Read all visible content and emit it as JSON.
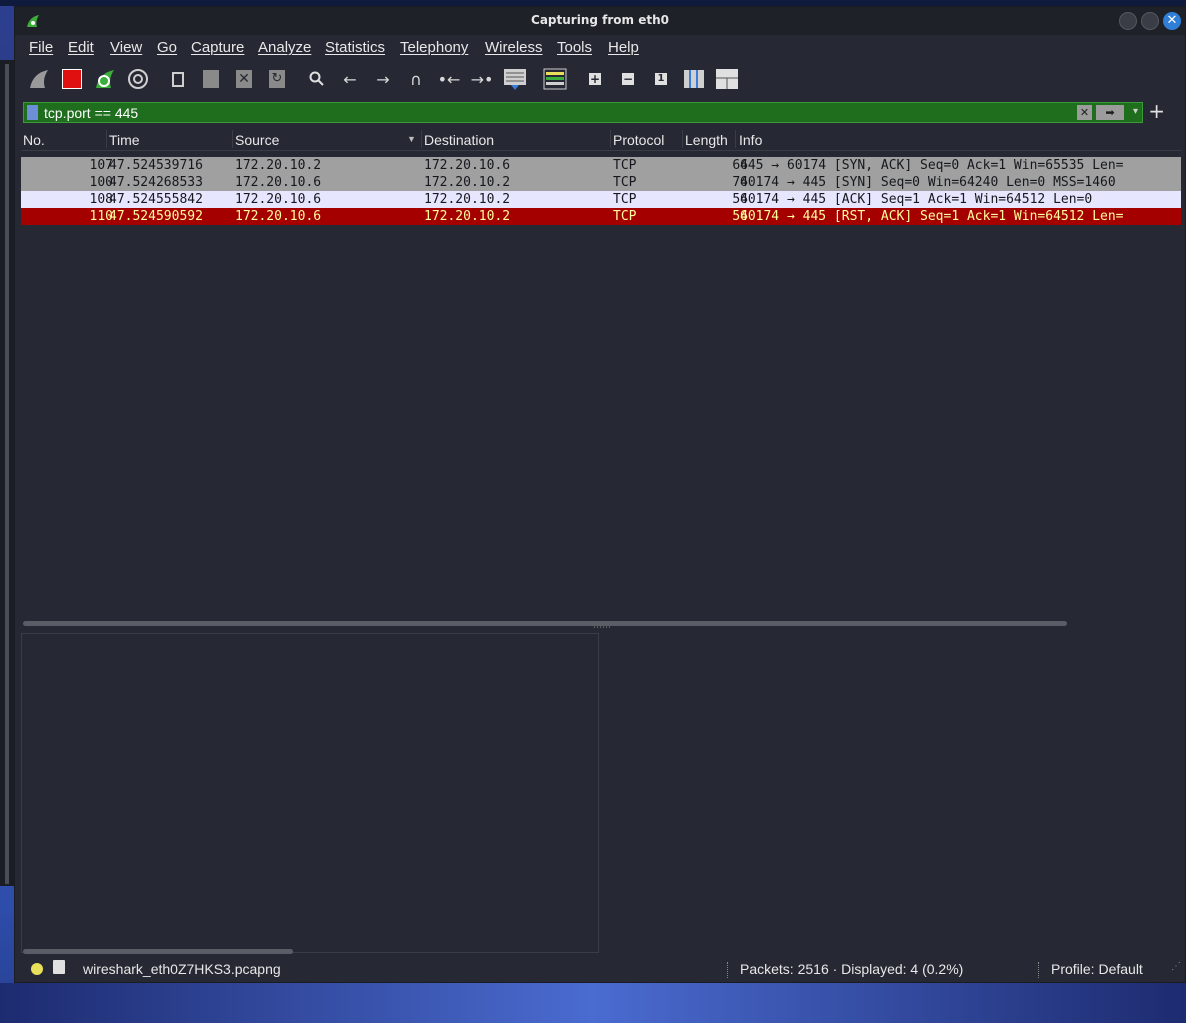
{
  "window": {
    "title": "Capturing from eth0"
  },
  "menu": [
    "File",
    "Edit",
    "View",
    "Go",
    "Capture",
    "Analyze",
    "Statistics",
    "Telephony",
    "Wireless",
    "Tools",
    "Help"
  ],
  "toolbar": {
    "icons": [
      "shark-fin-start-icon",
      "stop-capture-icon",
      "restart-capture-icon",
      "capture-options-icon",
      "open-file-icon",
      "save-file-icon",
      "close-file-icon",
      "reload-file-icon",
      "find-packet-icon",
      "go-back-icon",
      "go-forward-icon",
      "go-to-packet-icon",
      "go-first-icon",
      "go-last-icon",
      "autoscroll-icon",
      "colorize-icon",
      "zoom-in-icon",
      "zoom-out-icon",
      "normal-size-icon",
      "resize-columns-icon",
      "columns-icon"
    ]
  },
  "filter": {
    "value": "tcp.port == 445",
    "bg_color": "#1e6e1e"
  },
  "columns": [
    "No.",
    "Time",
    "Source",
    "Destination",
    "Protocol",
    "Length",
    "Info"
  ],
  "packets": [
    {
      "no": "107",
      "time": "47.524539716",
      "source": "172.20.10.2",
      "destination": "172.20.10.6",
      "protocol": "TCP",
      "length": "66",
      "info": "445 → 60174 [SYN, ACK] Seq=0 Ack=1 Win=65535 Len=",
      "bg": "#a0a0a0",
      "fg": "#16181d"
    },
    {
      "no": "100",
      "time": "47.524268533",
      "source": "172.20.10.6",
      "destination": "172.20.10.2",
      "protocol": "TCP",
      "length": "74",
      "info": "60174 → 445 [SYN] Seq=0 Win=64240 Len=0 MSS=1460",
      "bg": "#a0a0a0",
      "fg": "#16181d"
    },
    {
      "no": "108",
      "time": "47.524555842",
      "source": "172.20.10.6",
      "destination": "172.20.10.2",
      "protocol": "TCP",
      "length": "54",
      "info": "60174 → 445 [ACK] Seq=1 Ack=1 Win=64512 Len=0",
      "bg": "#e7e6ff",
      "fg": "#16181d"
    },
    {
      "no": "110",
      "time": "47.524590592",
      "source": "172.20.10.6",
      "destination": "172.20.10.2",
      "protocol": "TCP",
      "length": "54",
      "info": "60174 → 445 [RST, ACK] Seq=1 Ack=1 Win=64512 Len=",
      "bg": "#a40000",
      "fg": "#fffc9c"
    }
  ],
  "status": {
    "filename": "wireshark_eth0Z7HKS3.pcapng",
    "packets": "Packets: 2516 · Displayed: 4 (0.2%)",
    "profile": "Profile: Default",
    "led_color": "#e8e05a"
  }
}
